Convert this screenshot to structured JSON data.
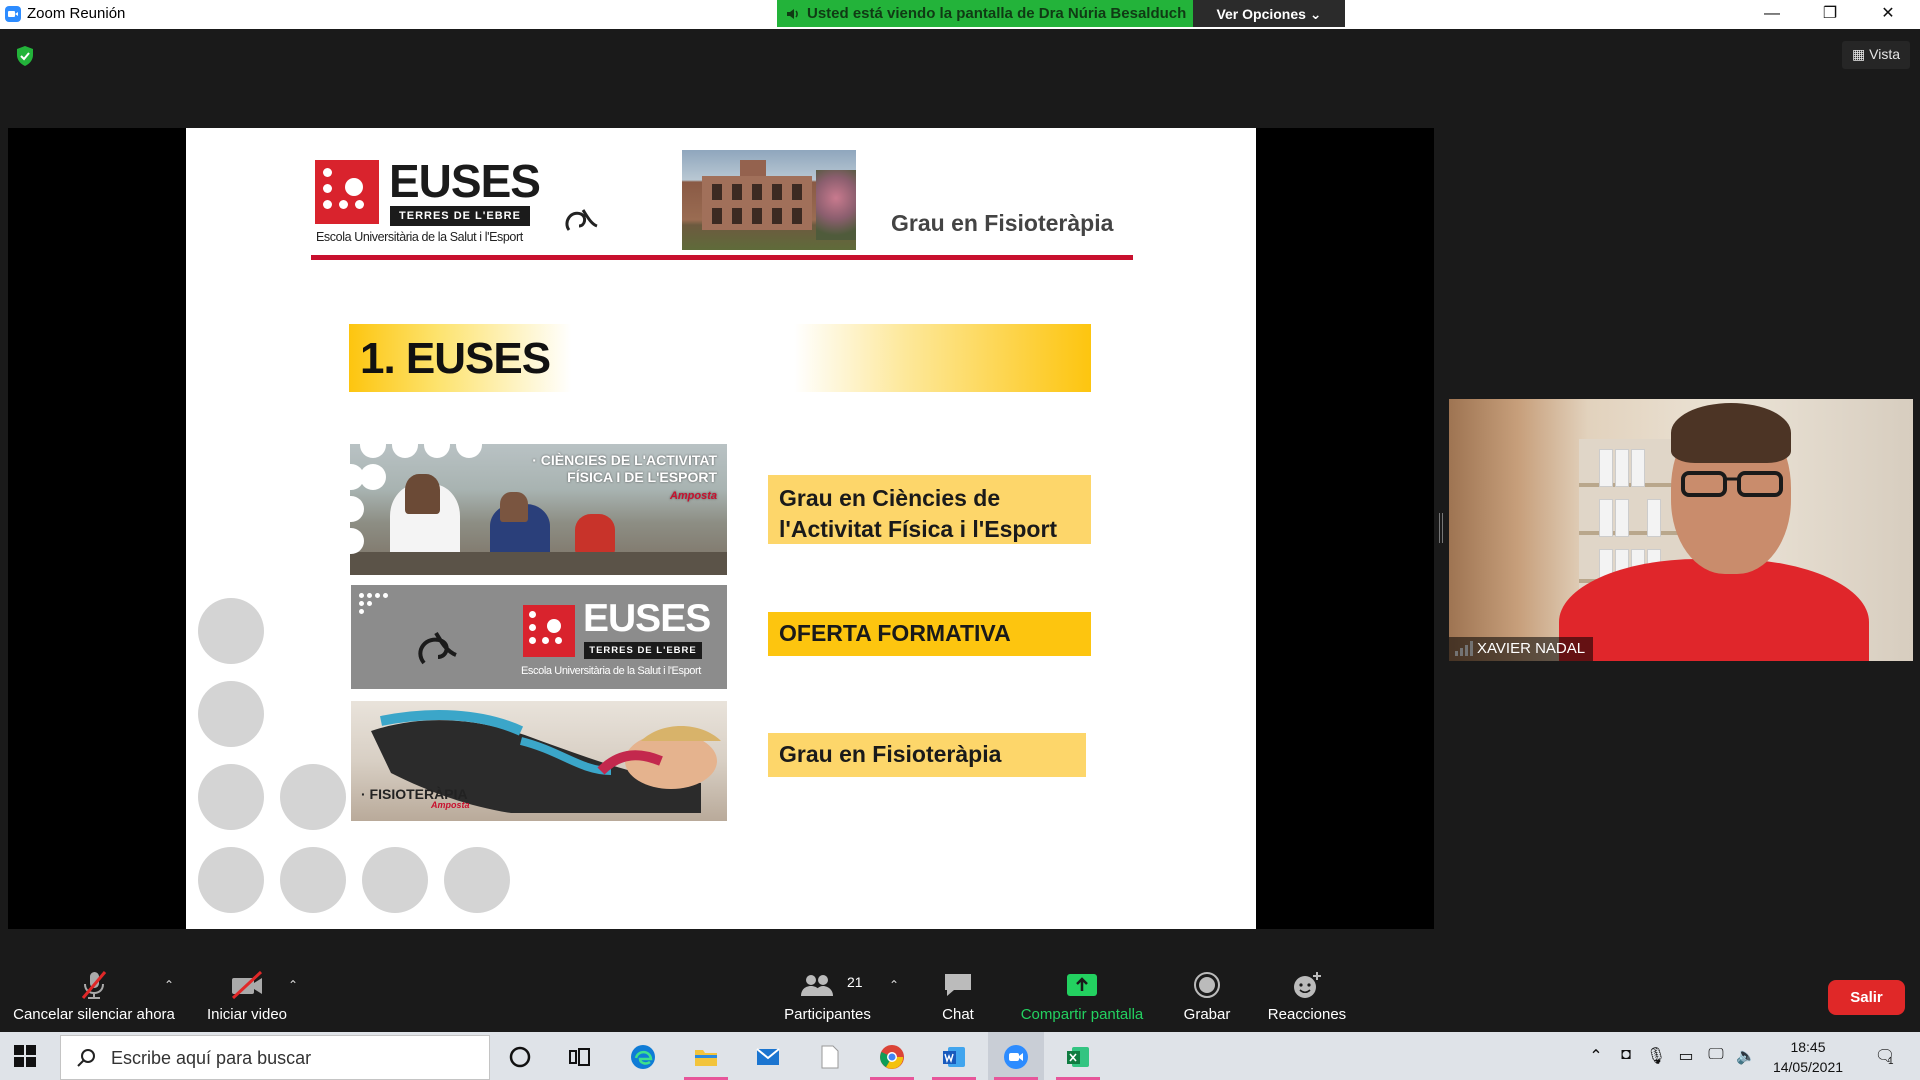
{
  "window": {
    "title": "Zoom Reunión",
    "share_banner": "Usted está viendo la pantalla de Dra Núria Besalduch",
    "view_options": "Ver Opciones ⌄",
    "minimize": "—",
    "restore": "❐",
    "close": "✕"
  },
  "meeting": {
    "view_label": "Vista",
    "participant_name": "XAVIER NADAL"
  },
  "slide": {
    "logo_word": "EUSES",
    "logo_tag": "TERRES DE L'EBRE",
    "logo_subtitle": "Escola Universitària de la Salut i l'Esport",
    "header_title": "Grau en Fisioteràpia",
    "section_title": "1. EUSES",
    "photo1_label_line1": "· CIÈNCIES DE L'ACTIVITAT",
    "photo1_label_line2": "FÍSICA I DE L'ESPORT",
    "photo1_label_city": "Amposta",
    "photo2_word": "EUSES",
    "photo2_tag": "TERRES DE L'EBRE",
    "photo2_subtitle": "Escola Universitària de la Salut i l'Esport",
    "photo3_label": "· FISIOTERÀPIA",
    "photo3_city": "Amposta",
    "box1": "Grau en Ciències de l'Activitat Física i l'Esport",
    "box2": "OFERTA FORMATIVA",
    "box3": "Grau en Fisioteràpia"
  },
  "controls": {
    "mute": "Cancelar silenciar ahora",
    "video": "Iniciar video",
    "participants": "Participantes",
    "participants_count": "21",
    "chat": "Chat",
    "share": "Compartir pantalla",
    "record": "Grabar",
    "reactions": "Reacciones",
    "leave": "Salir"
  },
  "taskbar": {
    "search_placeholder": "Escribe aquí para buscar",
    "time": "18:45",
    "date": "14/05/2021",
    "notifications": "1"
  },
  "colors": {
    "zoom_blue": "#2d8cff",
    "share_green": "#23b33a",
    "euses_red": "#d9232d",
    "slide_yellow": "#fdc50f",
    "leave_red": "#e02828"
  }
}
